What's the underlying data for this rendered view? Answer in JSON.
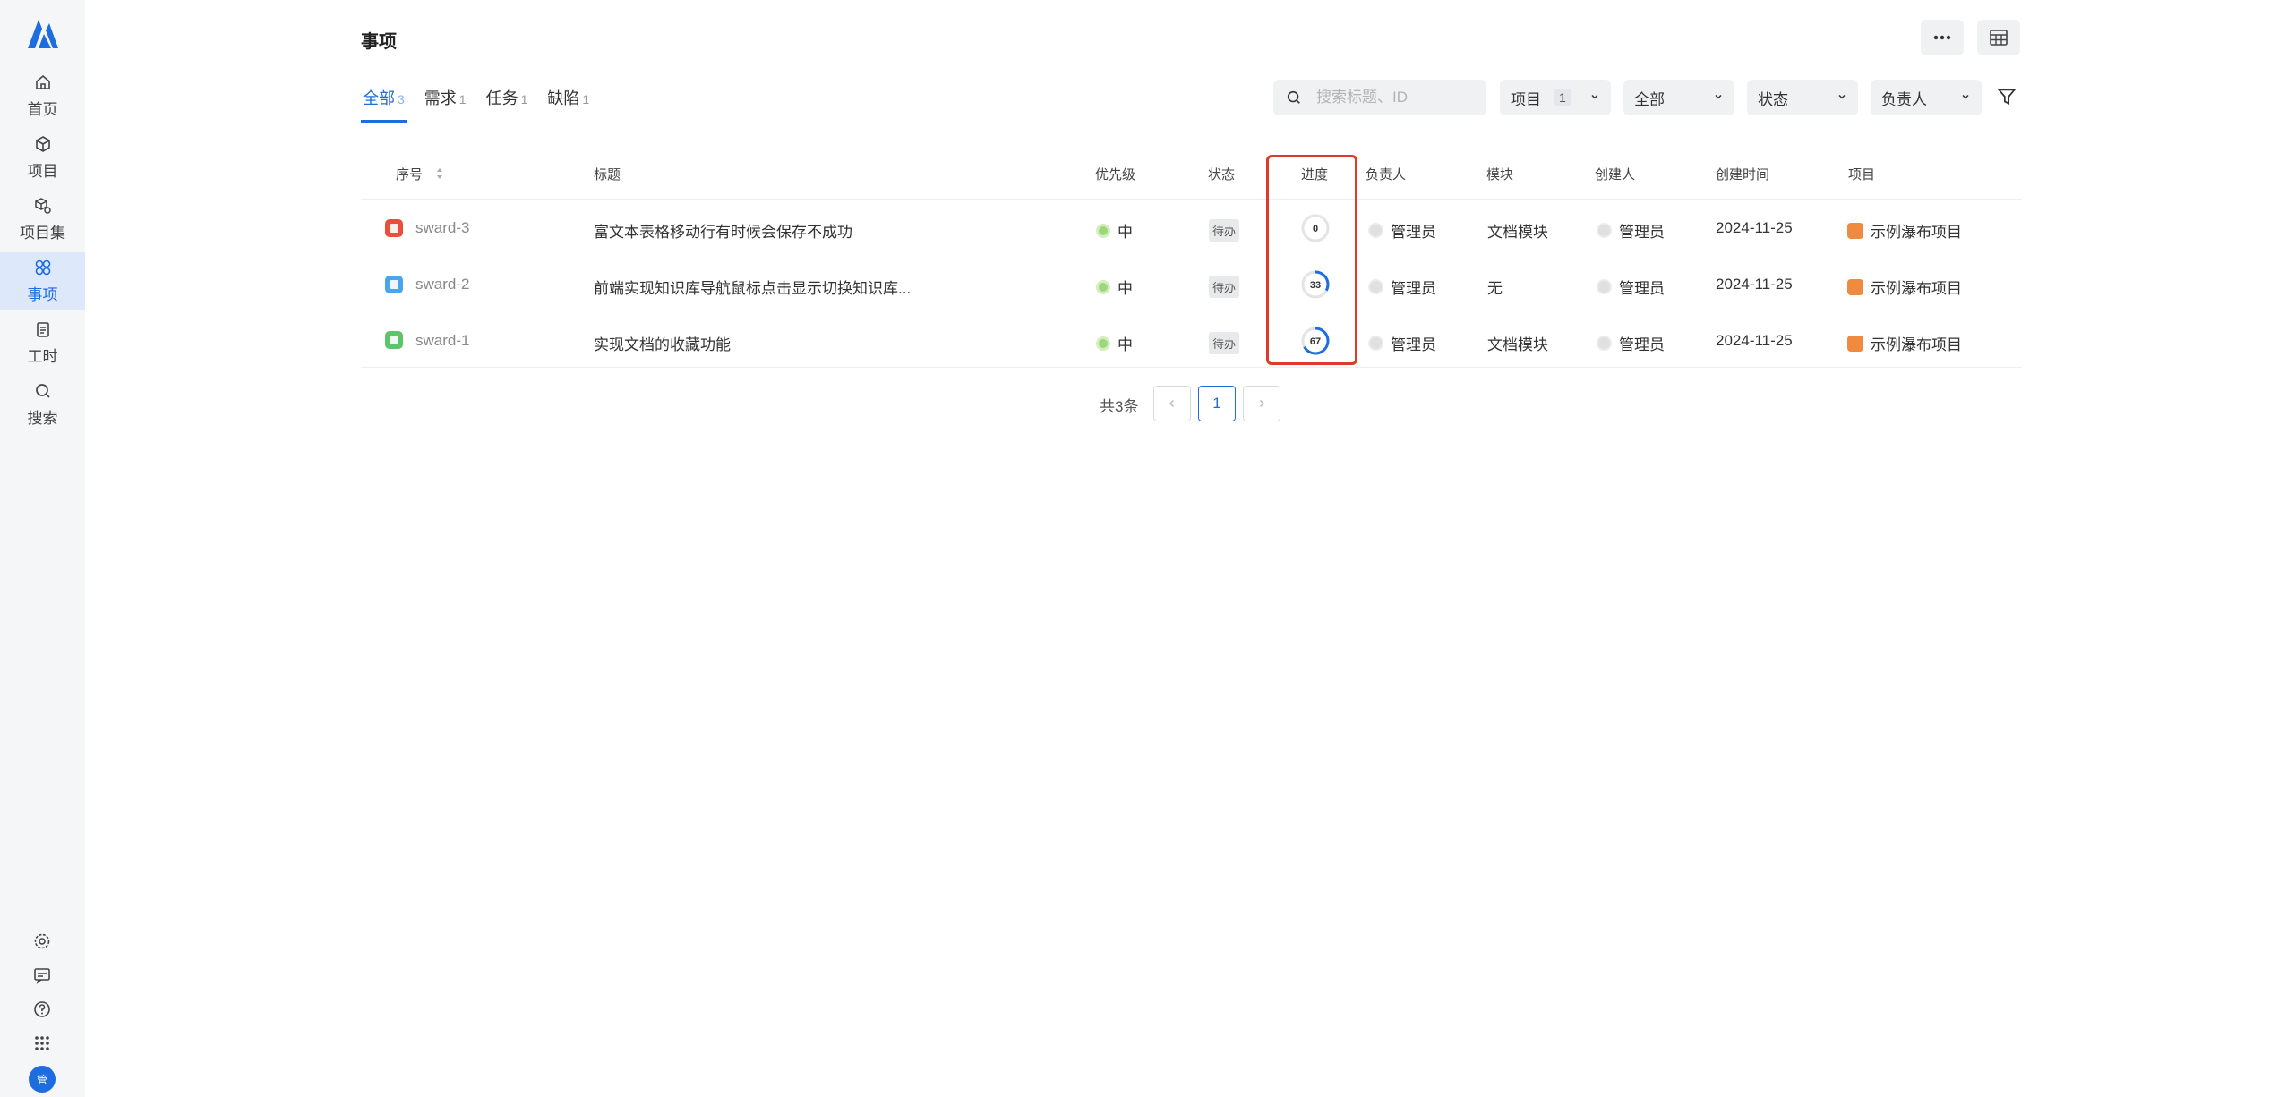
{
  "sidebar": {
    "items": [
      {
        "label": "首页",
        "icon": "home-icon"
      },
      {
        "label": "项目",
        "icon": "cube-icon"
      },
      {
        "label": "项目集",
        "icon": "cubes-icon"
      },
      {
        "label": "事项",
        "icon": "grid-icon"
      },
      {
        "label": "工时",
        "icon": "clipboard-icon"
      },
      {
        "label": "搜索",
        "icon": "search-icon"
      }
    ],
    "active": "事项",
    "bottom_icons": [
      "settings-icon",
      "message-icon",
      "help-icon",
      "apps-icon"
    ],
    "avatar_text": "管"
  },
  "header": {
    "title": "事项"
  },
  "tabs": [
    {
      "label": "全部",
      "count": "3"
    },
    {
      "label": "需求",
      "count": "1"
    },
    {
      "label": "任务",
      "count": "1"
    },
    {
      "label": "缺陷",
      "count": "1"
    }
  ],
  "filters": {
    "search_placeholder": "搜索标题、ID",
    "project_label": "项目",
    "project_count": "1",
    "all_label": "全部",
    "status_label": "状态",
    "assignee_label": "负责人"
  },
  "table": {
    "columns": [
      "序号",
      "标题",
      "优先级",
      "状态",
      "进度",
      "负责人",
      "模块",
      "创建人",
      "创建时间",
      "项目"
    ],
    "rows": [
      {
        "code": "sward-3",
        "title": "富文本表格移动行有时候会保存不成功",
        "priority": "中",
        "status": "待办",
        "progress": 0,
        "assignee": "管理员",
        "module": "文档模块",
        "creator": "管理员",
        "created": "2024-11-25",
        "project": "示例瀑布项目",
        "type_color": "#e8503a"
      },
      {
        "code": "sward-2",
        "title": "前端实现知识库导航鼠标点击显示切换知识库...",
        "priority": "中",
        "status": "待办",
        "progress": 33,
        "assignee": "管理员",
        "module": "无",
        "creator": "管理员",
        "created": "2024-11-25",
        "project": "示例瀑布项目",
        "type_color": "#4aa6e8"
      },
      {
        "code": "sward-1",
        "title": "实现文档的收藏功能",
        "priority": "中",
        "status": "待办",
        "progress": 67,
        "assignee": "管理员",
        "module": "文档模块",
        "creator": "管理员",
        "created": "2024-11-25",
        "project": "示例瀑布项目",
        "type_color": "#5cc46a"
      }
    ]
  },
  "pagination": {
    "total_text": "共3条",
    "current_page": "1"
  },
  "colors": {
    "accent": "#1d6de0",
    "highlight": "#e03a2e",
    "progress_ring": "#1d6de0"
  }
}
